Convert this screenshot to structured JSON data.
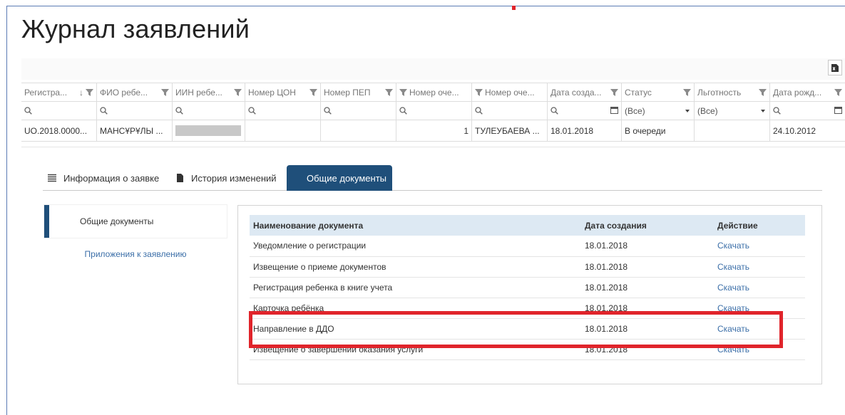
{
  "page_title": "Журнал заявлений",
  "colors": {
    "accent": "#1f4f7a",
    "link": "#3c6fa8",
    "highlight": "#e0242b",
    "table_header_bg": "#dde9f3"
  },
  "grid": {
    "columns": [
      {
        "label": "Регистра...",
        "sort": "↓"
      },
      {
        "label": "ФИО ребе..."
      },
      {
        "label": "ИИН ребе..."
      },
      {
        "label": "Номер ЦОН"
      },
      {
        "label": "Номер ПЕП"
      },
      {
        "label": "Номер оче..."
      },
      {
        "label": "Номер оче..."
      },
      {
        "label": "Дата созда..."
      },
      {
        "label": "Статус"
      },
      {
        "label": "Льготность"
      },
      {
        "label": "Дата рожд..."
      }
    ],
    "filters": {
      "status": "(Все)",
      "benefit": "(Все)"
    },
    "row": {
      "reg": "UO.2018.0000...",
      "fio": "МАНСҰРҰЛЫ ...",
      "queue_num": "1",
      "queue_name": "ТУЛЕУБАЕВА ...",
      "created": "18.01.2018",
      "status": "В очереди",
      "birth": "24.10.2012"
    }
  },
  "tabs": {
    "info": "Информация о заявке",
    "history": "История изменений",
    "docs": "Общие документы"
  },
  "side_nav": {
    "docs": "Общие документы",
    "attachments": "Приложения к заявлению"
  },
  "docs_table": {
    "headers": {
      "name": "Наименование документа",
      "date": "Дата создания",
      "action": "Действие"
    },
    "rows": [
      {
        "name": "Уведомление о регистрации",
        "date": "18.01.2018",
        "action": "Скачать"
      },
      {
        "name": "Извещение о приеме документов",
        "date": "18.01.2018",
        "action": "Скачать"
      },
      {
        "name": "Регистрация ребенка в книге учета",
        "date": "18.01.2018",
        "action": "Скачать"
      },
      {
        "name": "Карточка ребёнка",
        "date": "18.01.2018",
        "action": "Скачать"
      },
      {
        "name": "Направление в ДДО",
        "date": "18.01.2018",
        "action": "Скачать"
      },
      {
        "name": "Извещение о завершении оказания услуги",
        "date": "18.01.2018",
        "action": "Скачать"
      }
    ]
  }
}
